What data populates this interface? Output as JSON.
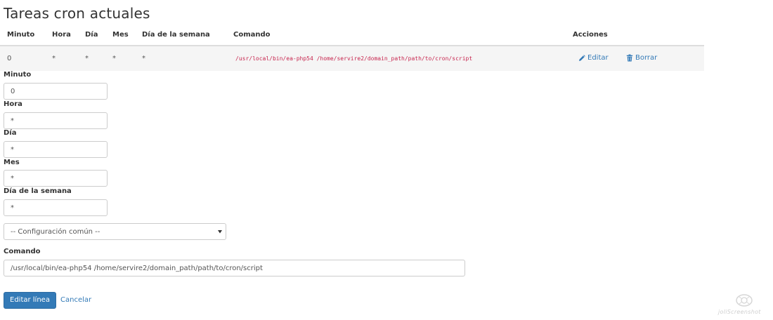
{
  "page_title": "Tareas cron actuales",
  "table": {
    "headers": {
      "minute": "Minuto",
      "hour": "Hora",
      "day": "Día",
      "month": "Mes",
      "weekday": "Día de la semana",
      "command": "Comando",
      "actions": "Acciones"
    },
    "row": {
      "minute": "0",
      "hour": "*",
      "day": "*",
      "month": "*",
      "weekday": "*",
      "command": "/usr/local/bin/ea-php54 /home/servire2/domain_path/path/to/cron/script",
      "edit_label": "Editar",
      "delete_label": "Borrar"
    }
  },
  "form": {
    "minute": {
      "label": "Minuto",
      "value": "0"
    },
    "hour": {
      "label": "Hora",
      "value": "*"
    },
    "day": {
      "label": "Día",
      "value": "*"
    },
    "month": {
      "label": "Mes",
      "value": "*"
    },
    "weekday": {
      "label": "Día de la semana",
      "value": "*"
    },
    "common_settings": {
      "selected": "-- Configuración común --"
    },
    "command": {
      "label": "Comando",
      "value": "/usr/local/bin/ea-php54 /home/servire2/domain_path/path/to/cron/script"
    },
    "submit_label": "Editar línea",
    "cancel_label": "Cancelar"
  },
  "watermark": {
    "text": "joliScreenshot"
  },
  "colors": {
    "primary": "#337ab7",
    "link": "#337ab7",
    "command_text": "#c7254e",
    "row_background": "#f5f5f5"
  },
  "icons": {
    "edit": "pencil-icon",
    "delete": "trash-icon",
    "select": "caret-down-icon"
  }
}
